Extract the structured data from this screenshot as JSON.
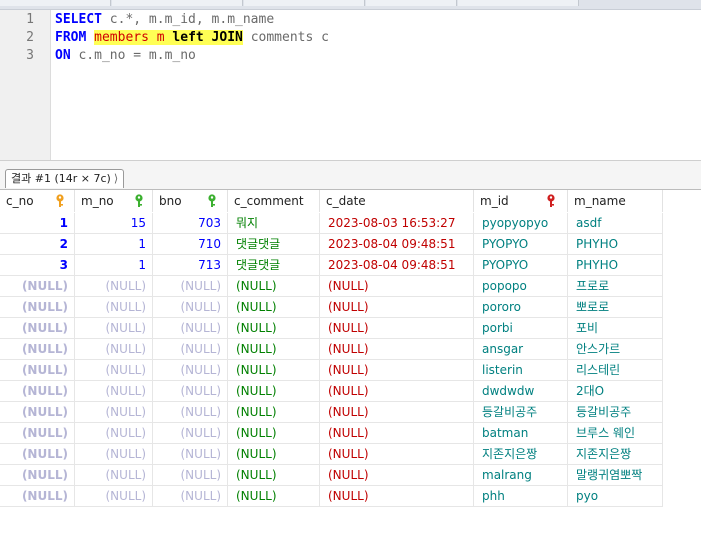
{
  "editor": {
    "line_numbers": [
      "1",
      "2",
      "3"
    ],
    "line1": {
      "kw": "SELECT",
      "rest": " c.*, m.m_id, m.m_name"
    },
    "line2": {
      "kw": "FROM",
      "sp": " ",
      "tbl": "members m",
      "sp2": " ",
      "join": "left JOIN",
      "rest": " comments c"
    },
    "line3": {
      "kw": "ON",
      "rest": " c.m_no = m.m_no"
    }
  },
  "result_tab": {
    "label": "결과 #1 (14r × 7c)",
    "close": "⟩"
  },
  "colors": {
    "key_orange": "#f0a020",
    "key_green": "#3cb030",
    "key_red": "#d02020",
    "highlight": "#ffff55"
  },
  "columns": [
    {
      "name": "c_no",
      "key_icon": "primary-key-icon"
    },
    {
      "name": "m_no",
      "key_icon": "foreign-key-icon"
    },
    {
      "name": "bno",
      "key_icon": "foreign-key-icon"
    },
    {
      "name": "c_comment"
    },
    {
      "name": "c_date"
    },
    {
      "name": "m_id",
      "key_icon": "unique-key-icon"
    },
    {
      "name": "m_name"
    }
  ],
  "rows": [
    [
      "1",
      "15",
      "703",
      "뭐지",
      "2023-08-03 16:53:27",
      "pyopyopyo",
      "asdf"
    ],
    [
      "2",
      "1",
      "710",
      "댓글댓글",
      "2023-08-04 09:48:51",
      "PYOPYO",
      "PHYHO"
    ],
    [
      "3",
      "1",
      "713",
      "댓글댓글",
      "2023-08-04 09:48:51",
      "PYOPYO",
      "PHYHO"
    ],
    [
      "(NULL)",
      "(NULL)",
      "(NULL)",
      "(NULL)",
      "(NULL)",
      "popopo",
      "프로로"
    ],
    [
      "(NULL)",
      "(NULL)",
      "(NULL)",
      "(NULL)",
      "(NULL)",
      "pororo",
      "뽀로로"
    ],
    [
      "(NULL)",
      "(NULL)",
      "(NULL)",
      "(NULL)",
      "(NULL)",
      "porbi",
      "포비"
    ],
    [
      "(NULL)",
      "(NULL)",
      "(NULL)",
      "(NULL)",
      "(NULL)",
      "ansgar",
      "안스가르"
    ],
    [
      "(NULL)",
      "(NULL)",
      "(NULL)",
      "(NULL)",
      "(NULL)",
      "listerin",
      "리스테린"
    ],
    [
      "(NULL)",
      "(NULL)",
      "(NULL)",
      "(NULL)",
      "(NULL)",
      "dwdwdw",
      "2대O"
    ],
    [
      "(NULL)",
      "(NULL)",
      "(NULL)",
      "(NULL)",
      "(NULL)",
      "등갈비공주",
      "등갈비공주"
    ],
    [
      "(NULL)",
      "(NULL)",
      "(NULL)",
      "(NULL)",
      "(NULL)",
      "batman",
      "브루스 웨인"
    ],
    [
      "(NULL)",
      "(NULL)",
      "(NULL)",
      "(NULL)",
      "(NULL)",
      "지존지은짱",
      "지존지은짱"
    ],
    [
      "(NULL)",
      "(NULL)",
      "(NULL)",
      "(NULL)",
      "(NULL)",
      "malrang",
      "말랭귀염뽀짝"
    ],
    [
      "(NULL)",
      "(NULL)",
      "(NULL)",
      "(NULL)",
      "(NULL)",
      "phh",
      "pyo"
    ]
  ]
}
